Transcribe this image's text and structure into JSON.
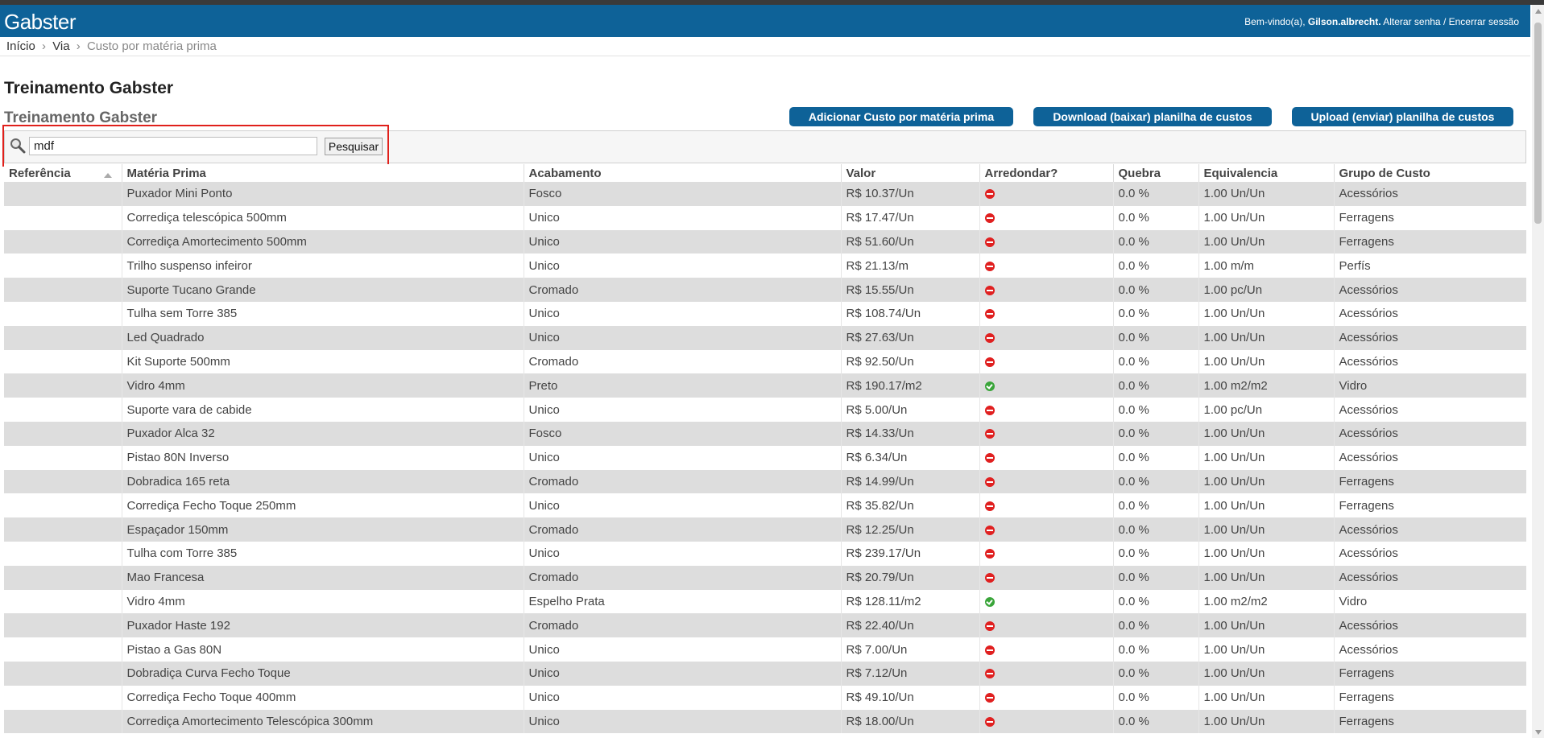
{
  "header": {
    "logo": "Gabster",
    "welcome_prefix": "Bem-vindo(a), ",
    "username": "Gilson.albrecht.",
    "change_password": " Alterar senha",
    "separator": " / ",
    "logout": "Encerrar sessão"
  },
  "breadcrumb": {
    "home": "Início",
    "sep": "›",
    "section": "Via",
    "current": "Custo por matéria prima"
  },
  "page_title": "Treinamento Gabster",
  "sub_title": "Treinamento Gabster",
  "buttons": {
    "add": "Adicionar Custo por matéria prima",
    "download": "Download (baixar) planilha de custos",
    "upload": "Upload (enviar) planilha de custos"
  },
  "search": {
    "value": "mdf",
    "button": "Pesquisar"
  },
  "table": {
    "columns": [
      "Referência",
      "Matéria Prima",
      "Acabamento",
      "Valor",
      "Arredondar?",
      "Quebra",
      "Equivalencia",
      "Grupo de Custo"
    ],
    "rows": [
      {
        "ref": "",
        "material": "Puxador Mini Ponto",
        "finish": "Fosco",
        "value": "R$ 10.37/Un",
        "round": "no",
        "waste": "0.0 %",
        "equiv": "1.00 Un/Un",
        "group": "Acessórios"
      },
      {
        "ref": "",
        "material": "Corrediça telescópica 500mm",
        "finish": "Unico",
        "value": "R$ 17.47/Un",
        "round": "no",
        "waste": "0.0 %",
        "equiv": "1.00 Un/Un",
        "group": "Ferragens"
      },
      {
        "ref": "",
        "material": "Corrediça Amortecimento 500mm",
        "finish": "Unico",
        "value": "R$ 51.60/Un",
        "round": "no",
        "waste": "0.0 %",
        "equiv": "1.00 Un/Un",
        "group": "Ferragens"
      },
      {
        "ref": "",
        "material": "Trilho suspenso infeiror",
        "finish": "Unico",
        "value": "R$ 21.13/m",
        "round": "no",
        "waste": "0.0 %",
        "equiv": "1.00 m/m",
        "group": "Perfís"
      },
      {
        "ref": "",
        "material": "Suporte Tucano Grande",
        "finish": "Cromado",
        "value": "R$ 15.55/Un",
        "round": "no",
        "waste": "0.0 %",
        "equiv": "1.00 pc/Un",
        "group": "Acessórios"
      },
      {
        "ref": "",
        "material": "Tulha sem Torre 385",
        "finish": "Unico",
        "value": "R$ 108.74/Un",
        "round": "no",
        "waste": "0.0 %",
        "equiv": "1.00 Un/Un",
        "group": "Acessórios"
      },
      {
        "ref": "",
        "material": "Led Quadrado",
        "finish": "Unico",
        "value": "R$ 27.63/Un",
        "round": "no",
        "waste": "0.0 %",
        "equiv": "1.00 Un/Un",
        "group": "Acessórios"
      },
      {
        "ref": "",
        "material": "Kit Suporte 500mm",
        "finish": "Cromado",
        "value": "R$ 92.50/Un",
        "round": "no",
        "waste": "0.0 %",
        "equiv": "1.00 Un/Un",
        "group": "Acessórios"
      },
      {
        "ref": "",
        "material": "Vidro 4mm",
        "finish": "Preto",
        "value": "R$ 190.17/m2",
        "round": "yes",
        "waste": "0.0 %",
        "equiv": "1.00 m2/m2",
        "group": "Vidro"
      },
      {
        "ref": "",
        "material": "Suporte vara de cabide",
        "finish": "Unico",
        "value": "R$ 5.00/Un",
        "round": "no",
        "waste": "0.0 %",
        "equiv": "1.00 pc/Un",
        "group": "Acessórios"
      },
      {
        "ref": "",
        "material": "Puxador Alca 32",
        "finish": "Fosco",
        "value": "R$ 14.33/Un",
        "round": "no",
        "waste": "0.0 %",
        "equiv": "1.00 Un/Un",
        "group": "Acessórios"
      },
      {
        "ref": "",
        "material": "Pistao 80N Inverso",
        "finish": "Unico",
        "value": "R$ 6.34/Un",
        "round": "no",
        "waste": "0.0 %",
        "equiv": "1.00 Un/Un",
        "group": "Acessórios"
      },
      {
        "ref": "",
        "material": "Dobradica 165 reta",
        "finish": "Cromado",
        "value": "R$ 14.99/Un",
        "round": "no",
        "waste": "0.0 %",
        "equiv": "1.00 Un/Un",
        "group": "Ferragens"
      },
      {
        "ref": "",
        "material": "Corrediça Fecho Toque 250mm",
        "finish": "Unico",
        "value": "R$ 35.82/Un",
        "round": "no",
        "waste": "0.0 %",
        "equiv": "1.00 Un/Un",
        "group": "Ferragens"
      },
      {
        "ref": "",
        "material": "Espaçador 150mm",
        "finish": "Cromado",
        "value": "R$ 12.25/Un",
        "round": "no",
        "waste": "0.0 %",
        "equiv": "1.00 Un/Un",
        "group": "Acessórios"
      },
      {
        "ref": "",
        "material": "Tulha com Torre 385",
        "finish": "Unico",
        "value": "R$ 239.17/Un",
        "round": "no",
        "waste": "0.0 %",
        "equiv": "1.00 Un/Un",
        "group": "Acessórios"
      },
      {
        "ref": "",
        "material": "Mao Francesa",
        "finish": "Cromado",
        "value": "R$ 20.79/Un",
        "round": "no",
        "waste": "0.0 %",
        "equiv": "1.00 Un/Un",
        "group": "Acessórios"
      },
      {
        "ref": "",
        "material": "Vidro 4mm",
        "finish": "Espelho Prata",
        "value": "R$ 128.11/m2",
        "round": "yes",
        "waste": "0.0 %",
        "equiv": "1.00 m2/m2",
        "group": "Vidro"
      },
      {
        "ref": "",
        "material": "Puxador Haste 192",
        "finish": "Cromado",
        "value": "R$ 22.40/Un",
        "round": "no",
        "waste": "0.0 %",
        "equiv": "1.00 Un/Un",
        "group": "Acessórios"
      },
      {
        "ref": "",
        "material": "Pistao a Gas 80N",
        "finish": "Unico",
        "value": "R$ 7.00/Un",
        "round": "no",
        "waste": "0.0 %",
        "equiv": "1.00 Un/Un",
        "group": "Acessórios"
      },
      {
        "ref": "",
        "material": "Dobradiça Curva Fecho Toque",
        "finish": "Unico",
        "value": "R$ 7.12/Un",
        "round": "no",
        "waste": "0.0 %",
        "equiv": "1.00 Un/Un",
        "group": "Ferragens"
      },
      {
        "ref": "",
        "material": "Corrediça Fecho Toque 400mm",
        "finish": "Unico",
        "value": "R$ 49.10/Un",
        "round": "no",
        "waste": "0.0 %",
        "equiv": "1.00 Un/Un",
        "group": "Ferragens"
      },
      {
        "ref": "",
        "material": "Corrediça Amortecimento Telescópica 300mm",
        "finish": "Unico",
        "value": "R$ 18.00/Un",
        "round": "no",
        "waste": "0.0 %",
        "equiv": "1.00 Un/Un",
        "group": "Ferragens"
      }
    ]
  },
  "icons": {
    "round_no": "no-entry-icon",
    "round_yes": "check-circle-icon",
    "search": "magnifier-icon"
  },
  "colors": {
    "brand": "#0e6298",
    "row_alt": "#dddddd",
    "highlight": "#e0201b",
    "no": "#e02020",
    "yes": "#3aa53a"
  }
}
